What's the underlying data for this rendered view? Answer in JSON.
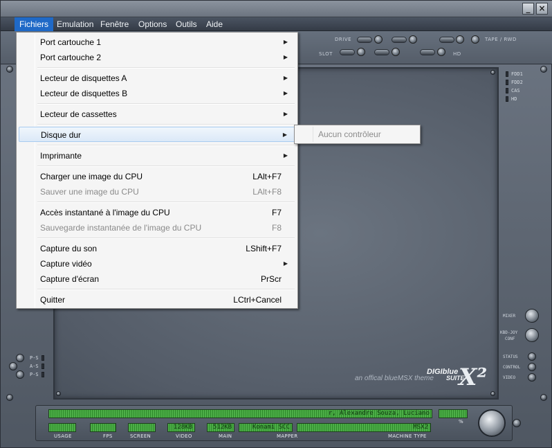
{
  "titlebar": {
    "minimize_glyph": "_",
    "close_glyph": "×"
  },
  "menubar": [
    {
      "label": "Fichiers"
    },
    {
      "label": "Emulation"
    },
    {
      "label": "Fenêtre"
    },
    {
      "label": "Options"
    },
    {
      "label": "Outils"
    },
    {
      "label": "Aide"
    }
  ],
  "toppanel": {
    "drive": "DRIVE",
    "tape": "TAPE / RWD",
    "slot": "SLOT",
    "hd": "HD"
  },
  "fichiers_menu": {
    "port1": "Port cartouche 1",
    "port2": "Port cartouche 2",
    "floppyA": "Lecteur de disquettes A",
    "floppyB": "Lecteur de disquettes B",
    "cassette": "Lecteur de cassettes",
    "harddisk": "Disque dur",
    "printer": "Imprimante",
    "load_cpu": "Charger une image du CPU",
    "load_cpu_sc": "LAlt+F7",
    "save_cpu": "Sauver une image du CPU",
    "save_cpu_sc": "LAlt+F8",
    "quick_load": "Accès instantané à l'image du CPU",
    "quick_load_sc": "F7",
    "quick_save": "Sauvegarde instantanée de l'image du CPU",
    "quick_save_sc": "F8",
    "audio_cap": "Capture du son",
    "audio_cap_sc": "LShift+F7",
    "video_cap": "Capture vidéo",
    "screen_cap": "Capture d'écran",
    "screen_cap_sc": "PrScr",
    "quit": "Quitter",
    "quit_sc": "LCtrl+Cancel"
  },
  "harddisk_submenu": {
    "item": "Aucun contrôleur"
  },
  "side_leds": [
    "FDD1",
    "FDD2",
    "CAS",
    "HD"
  ],
  "side_controls": {
    "mixer": "MIXER",
    "kbd": "KBD-JOY",
    "conf": "CONF",
    "status": "STATUS",
    "control": "CONTROL",
    "video": "VIDEO"
  },
  "left_leds": [
    "P-S",
    "A-S",
    "P-S"
  ],
  "logo": {
    "brand": "DIGIblue",
    "suite": "SUITE",
    "tagline": "an offical blueMSX theme"
  },
  "bottombar": {
    "ticker": "r, Alexandre Souza, Luciano",
    "percent_label": "%",
    "usage": "USAGE",
    "fps": "FPS",
    "screen": "SCREEN",
    "video_val": "128KB",
    "video": "VIDEO",
    "main_val": "512KB",
    "main": "MAIN",
    "mapper_val": "Konami SCC",
    "mapper": "MAPPER",
    "machine_val": "MSX2",
    "machine": "MACHINE TYPE"
  }
}
